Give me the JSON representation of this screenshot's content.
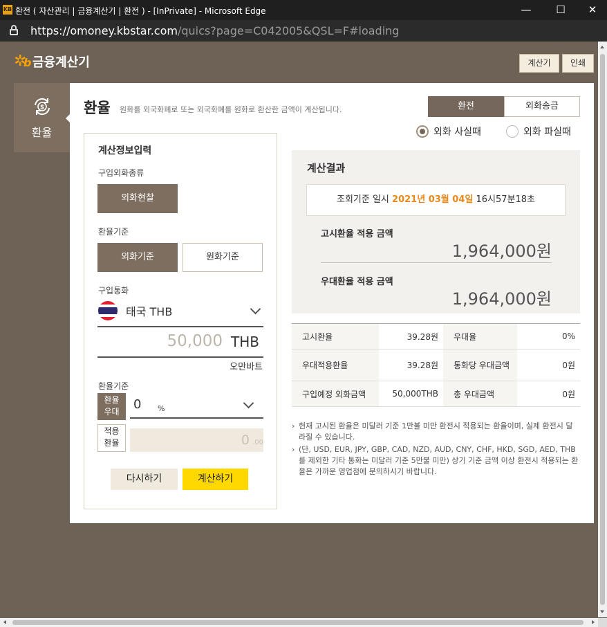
{
  "browser": {
    "title": "환전 ( 자산관리 | 금융계산기 | 환전 ) - [InPrivate] - Microsoft Edge",
    "favicon": "kb-logo-icon",
    "minimize": "—",
    "maximize": "☐",
    "close": "✕",
    "url_host": "https://omoney.kbstar.com",
    "url_path": "/quics?page=C042005&QSL=F#loading"
  },
  "header": {
    "logo_star": "✲",
    "logo_b": "b",
    "logo_text": "금융계산기",
    "calculator_btn": "계산기",
    "print_btn": "인쇄"
  },
  "sidebar": {
    "tab_label": "환율",
    "icon": "exchange-icon"
  },
  "main": {
    "title": "환율",
    "description": "원화를 외국화폐로 또는 외국화폐를 원화로 환산한 금액이 계산됩니다.",
    "tabs": [
      {
        "label": "환전",
        "active": true
      },
      {
        "label": "외화송금",
        "active": false
      }
    ],
    "radios": [
      {
        "label": "외화 사실때",
        "checked": true
      },
      {
        "label": "외화 파실때",
        "checked": false
      }
    ]
  },
  "input": {
    "title": "계산정보입력",
    "purchase_type_label": "구입외화종류",
    "purchase_type_btn": "외화현찰",
    "basis_label": "환율기준",
    "basis_foreign": "외화기준",
    "basis_won": "원화기준",
    "currency_label": "구입통화",
    "currency_name": "태국 THB",
    "amount": "50,000",
    "amount_unit": "THB",
    "amount_korean": "오만바트",
    "rate_basis_label": "환율기준",
    "pref_btn_line1": "환율",
    "pref_btn_line2": "우대",
    "pref_value": "0",
    "pref_unit": "%",
    "applied_btn_line1": "적용",
    "applied_btn_line2": "환율",
    "applied_value": "0",
    "applied_decimal": ".00",
    "reset_btn": "다시하기",
    "calc_btn": "계산하기"
  },
  "result": {
    "title": "계산결과",
    "time_prefix": "조회기준 일시",
    "time_date": "2021년 03월 04일",
    "time_clock": "16시57분18초",
    "notice_label": "고시환율 적용 금액",
    "notice_value": "1,964,000원",
    "pref_label": "우대환율 적용 금액",
    "pref_value": "1,964,000원"
  },
  "table": {
    "rows": [
      {
        "k1": "고시환율",
        "v1": "39.28원",
        "k2": "우대율",
        "v2": "0%"
      },
      {
        "k1": "우대적용환율",
        "v1": "39.28원",
        "k2": "통화당 우대금액",
        "v2": "0원"
      },
      {
        "k1": "구입예정 외화금액",
        "v1": "50,000THB",
        "k2": "총 우대금액",
        "v2": "0원"
      }
    ]
  },
  "notes": [
    "현재 고시된 환율은 미달러 기준 1만불 미만 환전시 적용되는 환율이며, 실제 환전시 달라질 수 있습니다.",
    "(단, USD, EUR, JPY, GBP, CAD, NZD, AUD, CNY, CHF, HKD, SGD, AED, THB를 제외한 기타 통화는 미달러 기준 5만불 미만) 상기 기준 금액 이상 환전시 적용되는 환율은 가까운 영업점에 문의하시기 바랍니다."
  ],
  "note_marker": "›",
  "colors": {
    "page_bg": "#6e6156",
    "brand_brown": "#74665a",
    "accent_yellow": "#ffd800",
    "highlight_orange": "#e8891a",
    "logo_orange": "#f5a100"
  }
}
